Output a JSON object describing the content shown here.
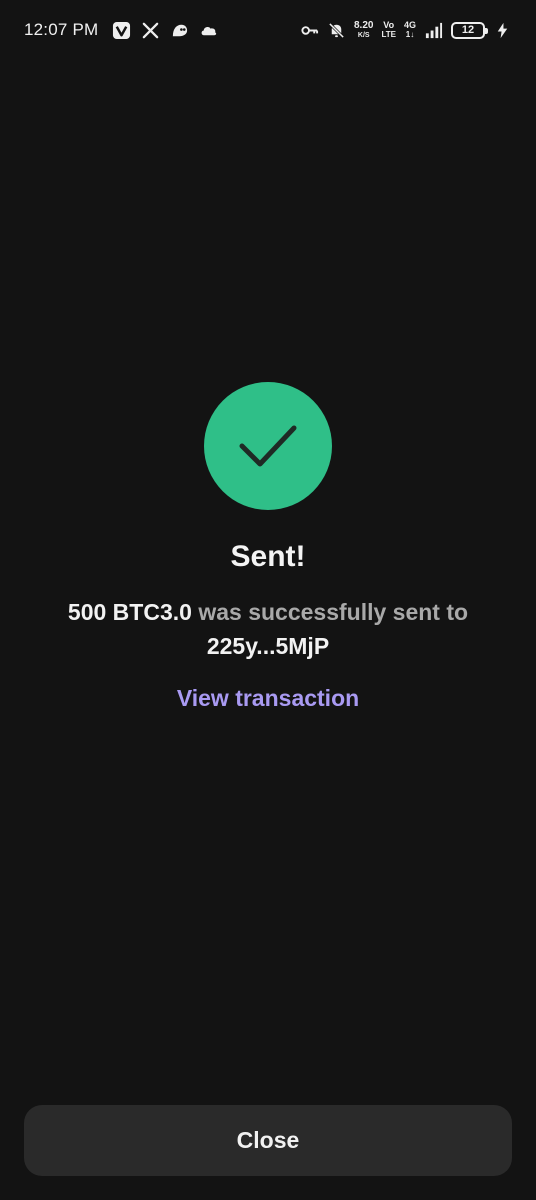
{
  "status_bar": {
    "time": "12:07 PM",
    "net_speed_value": "8.20",
    "net_speed_unit": "K/S",
    "volte_top": "Vo",
    "volte_bottom": "LTE",
    "network_top": "4G",
    "network_bottom": "1↓",
    "battery_level": "12",
    "icons": [
      "v-app-icon",
      "x-icon",
      "ghost-app-icon",
      "cloud-icon",
      "key-icon",
      "bell-muted-icon",
      "signal-icon",
      "charging-icon"
    ]
  },
  "success": {
    "icon": "checkmark-icon",
    "accent_color": "#2fbf88",
    "title": "Sent!",
    "amount": "500 BTC3.0",
    "middle_text": " was successfully sent to ",
    "recipient": "225y...5MjP",
    "view_link": "View transaction",
    "link_color": "#a99af2"
  },
  "footer": {
    "close_label": "Close"
  }
}
